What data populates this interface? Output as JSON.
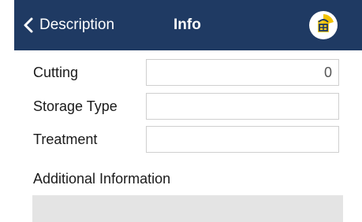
{
  "header": {
    "back_label": "Description",
    "title": "Info",
    "logo_icon": "logo-icon",
    "background_color": "#1f3a63"
  },
  "form": {
    "cutting": {
      "label": "Cutting",
      "value": "0"
    },
    "storage_type": {
      "label": "Storage Type",
      "value": ""
    },
    "treatment": {
      "label": "Treatment",
      "value": ""
    }
  },
  "additional": {
    "label": "Additional Information",
    "value": ""
  }
}
